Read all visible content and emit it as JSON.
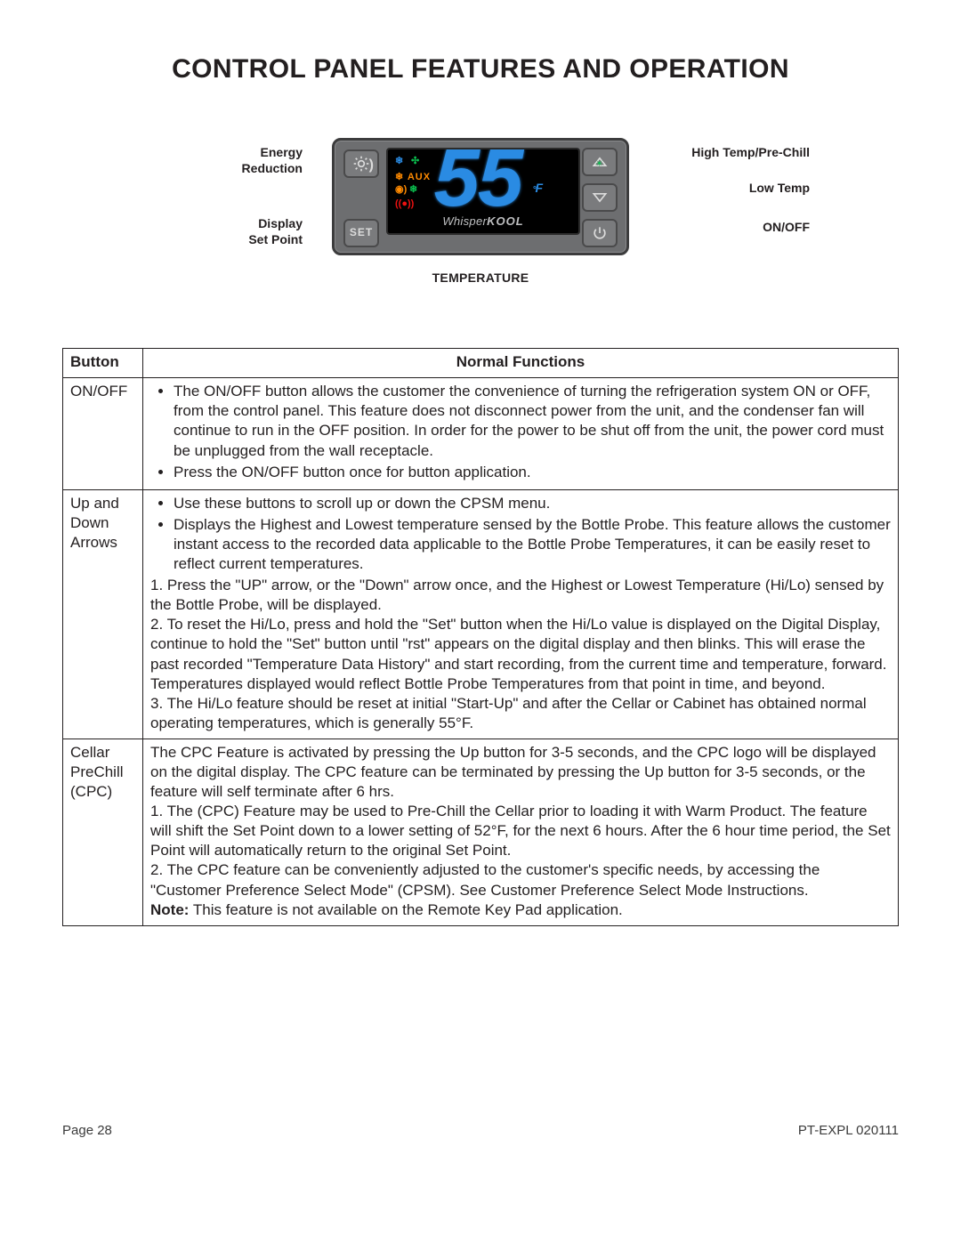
{
  "title": "CONTROL PANEL FEATURES AND OPERATION",
  "diagram": {
    "display_value": "55",
    "display_unit": "F",
    "brand_prefix": "Whisper",
    "brand_bold": "KOOL",
    "temperature_label": "TEMPERATURE",
    "buttons": {
      "set_label": "SET"
    },
    "callouts": {
      "energy_reduction": "Energy\nReduction",
      "display_set_point": "Display\nSet Point",
      "high_temp": "High Temp/Pre-Chill",
      "low_temp": "Low Temp",
      "on_off": "ON/OFF"
    }
  },
  "table": {
    "headers": {
      "button": "Button",
      "functions": "Normal Functions"
    },
    "rows": [
      {
        "button": "ON/OFF",
        "bullets": [
          "The ON/OFF button allows the customer the convenience of turning the refrigeration system ON or OFF, from the control panel.  This feature does not disconnect power from the unit, and the condenser fan will continue to run in the OFF position.  In order for the power to be shut off from the unit, the power cord must be unplugged from the wall receptacle.",
          "Press the ON/OFF button once for button application."
        ]
      },
      {
        "button": "Up and Down Arrows",
        "bullets": [
          "Use these buttons to scroll up or down the CPSM menu.",
          "Displays the Highest and Lowest temperature sensed by the Bottle Probe.  This feature allows the customer instant access to the recorded data applicable to the Bottle Probe Temperatures, it can be easily reset to reflect current temperatures."
        ],
        "numbered": [
          "1.  Press the \"UP\" arrow, or the \"Down\" arrow once, and the Highest or Lowest Temperature (Hi/Lo) sensed by the Bottle Probe, will be displayed.",
          "2.  To reset the Hi/Lo, press and hold the \"Set\" button when the Hi/Lo value is displayed on the Digital Display, continue to hold the \"Set\" button until \"rst\" appears on the digital display and then blinks.  This will erase the past recorded \"Temperature Data History\" and start recording, from the current time and temperature, forward.  Temperatures displayed would reflect Bottle Probe Temperatures from that point in time, and beyond.",
          "3.  The Hi/Lo feature should be reset at initial \"Start-Up\" and after the Cellar or Cabinet has obtained normal operating temperatures, which is generally 55°F."
        ]
      },
      {
        "button": "Cellar PreChill (CPC)",
        "intro": "The CPC Feature is activated by pressing the Up button for 3-5 seconds, and the CPC logo will be displayed on the digital display.  The CPC feature can be terminated by pressing the Up button for 3-5 seconds, or the feature will self terminate after 6 hrs.",
        "numbered": [
          "1.  The (CPC) Feature may be used to Pre-Chill the Cellar prior to loading it with Warm Product.  The feature will shift the Set Point down to a lower setting of 52°F, for the next 6 hours.  After the 6 hour time period, the Set Point will automatically return to the original Set Point.",
          "2.  The CPC feature can be conveniently adjusted to the customer's specific needs, by accessing the \"Customer Preference Select Mode\" (CPSM).  See Customer Preference Select Mode Instructions."
        ],
        "note_label": "Note:",
        "note_text": " This feature is not available on the Remote Key Pad application."
      }
    ]
  },
  "footer": {
    "left": "Page 28",
    "right": "PT-EXPL 020111"
  }
}
